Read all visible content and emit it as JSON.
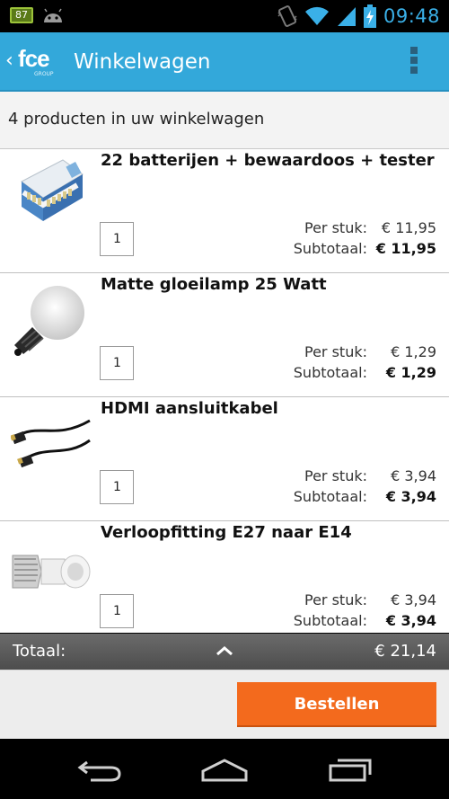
{
  "status_bar": {
    "badge": "87",
    "time": "09:48",
    "icons": [
      "android-debug-icon",
      "vibrate-icon",
      "wifi-icon",
      "signal-icon",
      "battery-charging-icon"
    ],
    "accent": "#3ab0e8"
  },
  "app_bar": {
    "logo": "fce",
    "logo_sub": "GROUP",
    "title": "Winkelwagen",
    "color": "#33a8da"
  },
  "cart": {
    "count_text": "4 producten in uw winkelwagen",
    "items": [
      {
        "name": "22 batterijen + bewaardoos + tester",
        "qty": "1",
        "unit_label": "Per stuk:",
        "unit_price": "€ 11,95",
        "subtotal_label": "Subtotaal:",
        "subtotal": "€ 11,95",
        "image_icon": "battery-box-image"
      },
      {
        "name": "Matte gloeilamp 25 Watt",
        "qty": "1",
        "unit_label": "Per stuk:",
        "unit_price": "€ 1,29",
        "subtotal_label": "Subtotaal:",
        "subtotal": "€ 1,29",
        "image_icon": "light-bulb-image"
      },
      {
        "name": "HDMI aansluitkabel",
        "qty": "1",
        "unit_label": "Per stuk:",
        "unit_price": "€ 3,94",
        "subtotal_label": "Subtotaal:",
        "subtotal": "€ 3,94",
        "image_icon": "hdmi-cable-image"
      },
      {
        "name": "Verloopfitting E27 naar E14",
        "qty": "1",
        "unit_label": "Per stuk:",
        "unit_price": "€ 3,94",
        "subtotal_label": "Subtotaal:",
        "subtotal": "€ 3,94",
        "image_icon": "socket-adapter-image"
      }
    ]
  },
  "totals": {
    "label": "Totaal:",
    "value": "€ 21,14"
  },
  "order_button": {
    "label": "Bestellen",
    "color": "#f36a1d"
  },
  "nav_bar": {
    "buttons": [
      "back-icon",
      "home-icon",
      "recent-apps-icon"
    ]
  }
}
